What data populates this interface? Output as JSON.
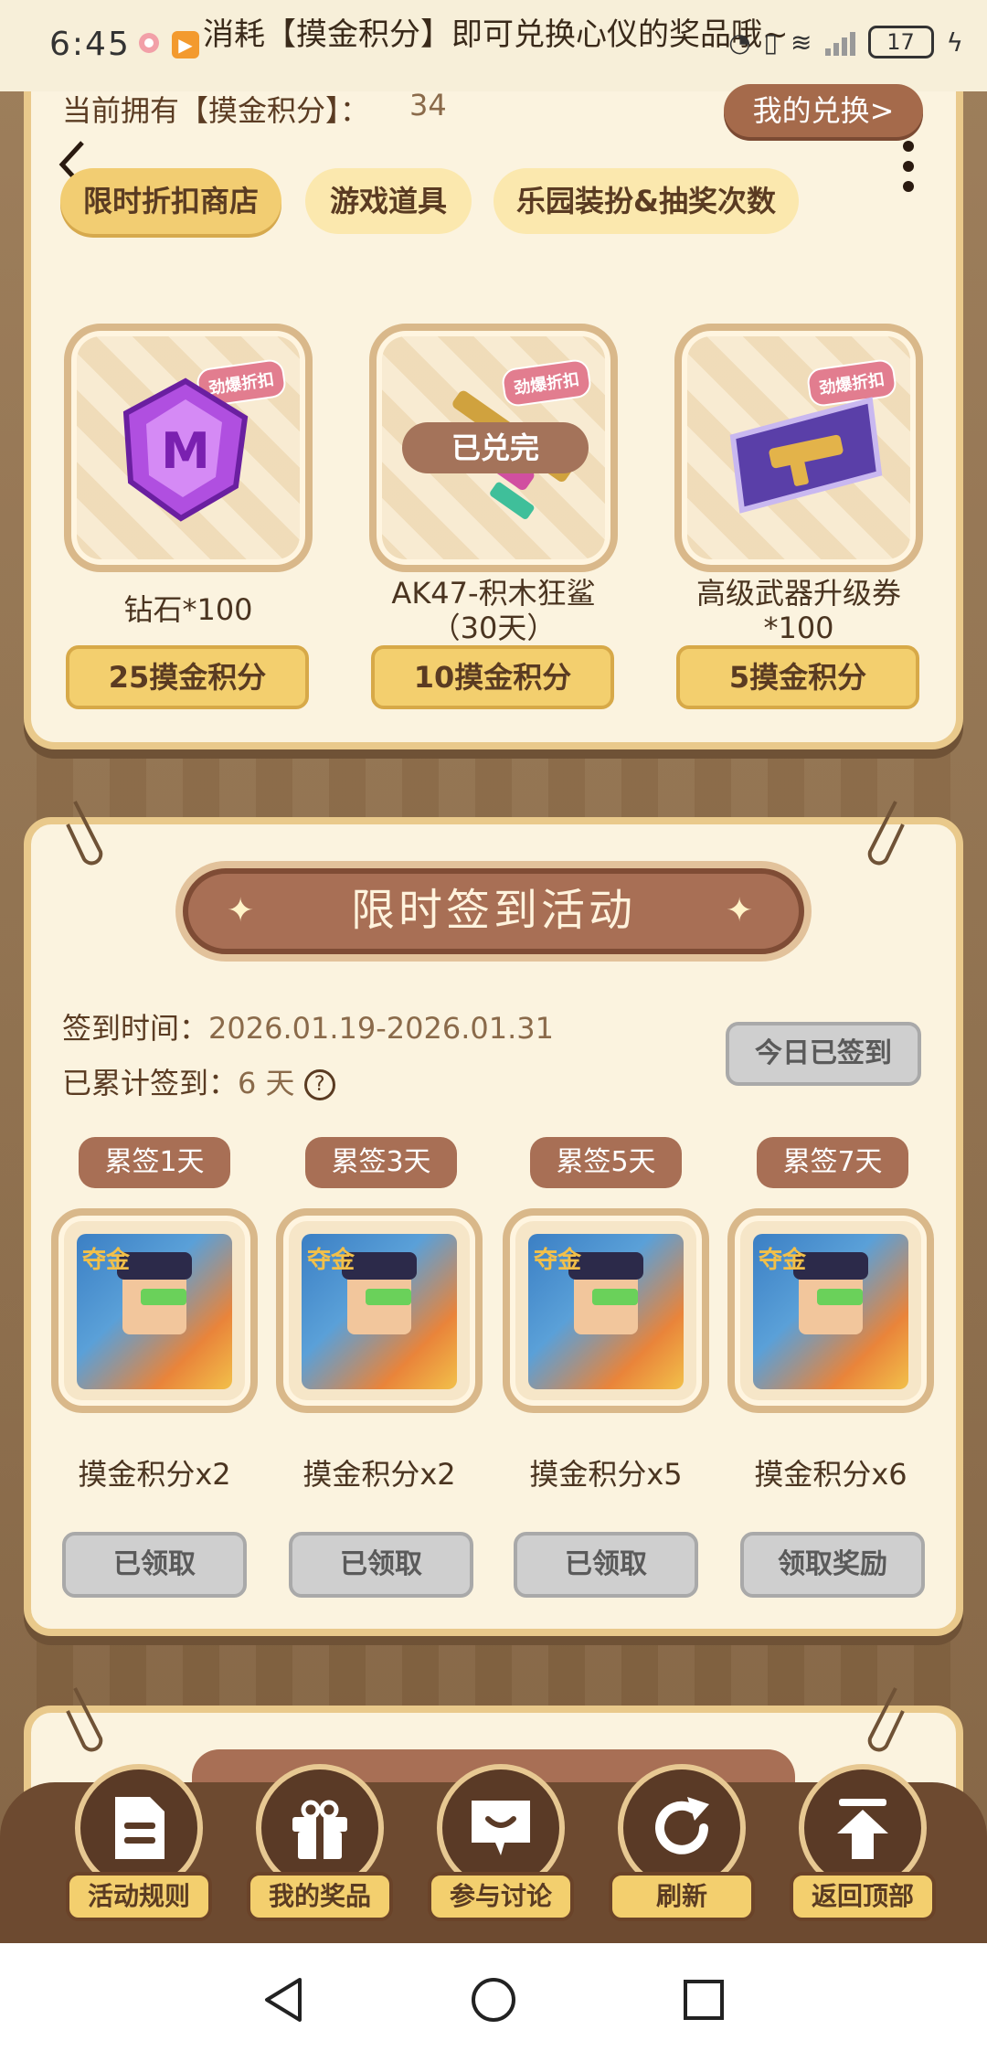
{
  "status_bar": {
    "time": "6:45",
    "battery": "17"
  },
  "marquee": "消耗【摸金积分】即可兑换心仪的奖品哦~",
  "header": {
    "points_label": "当前拥有【摸金积分】：",
    "points_value": "34",
    "my_exchange": "我的兑换>"
  },
  "tabs": [
    {
      "label": "限时折扣商店",
      "active": true
    },
    {
      "label": "游戏道具",
      "active": false
    },
    {
      "label": "乐园装扮&抽奖次数",
      "active": false
    }
  ],
  "shop_items": [
    {
      "name": "钻石*100",
      "price": "25摸金积分",
      "badge": "劲爆折扣",
      "sold_out": "",
      "icon": "gem-icon"
    },
    {
      "name": "AK47-积木狂鲨\n（30天）",
      "name_line1": "AK47-积木狂鲨",
      "name_line2": "（30天）",
      "price": "10摸金积分",
      "badge": "劲爆折扣",
      "sold_out": "已兑完",
      "icon": "rifle-icon"
    },
    {
      "name_line1": "高级武器升级券",
      "name_line2": "*100",
      "price": "5摸金积分",
      "badge": "劲爆折扣",
      "sold_out": "",
      "icon": "weapon-ticket-icon"
    }
  ],
  "signin": {
    "title": "限时签到活动",
    "time_label": "签到时间：",
    "time_value": "2026.01.19-2026.01.31",
    "count_label": "已累计签到：",
    "count_value": "6 天",
    "signed_today": "今日已签到",
    "rewards": [
      {
        "tag": "累签1天",
        "label": "摸金积分x2",
        "button": "已领取"
      },
      {
        "tag": "累签3天",
        "label": "摸金积分x2",
        "button": "已领取"
      },
      {
        "tag": "累签5天",
        "label": "摸金积分x5",
        "button": "已领取"
      },
      {
        "tag": "累签7天",
        "label": "摸金积分x6",
        "button": "领取奖励"
      }
    ]
  },
  "dock": [
    {
      "label": "活动规则",
      "icon": "document-icon"
    },
    {
      "label": "我的奖品",
      "icon": "gift-icon"
    },
    {
      "label": "参与讨论",
      "icon": "chat-icon"
    },
    {
      "label": "刷新",
      "icon": "refresh-icon"
    },
    {
      "label": "返回顶部",
      "icon": "upload-icon"
    }
  ],
  "colors": {
    "accent_gold": "#f3cf6e",
    "brown": "#a86f55",
    "panel": "#fbf3df"
  }
}
